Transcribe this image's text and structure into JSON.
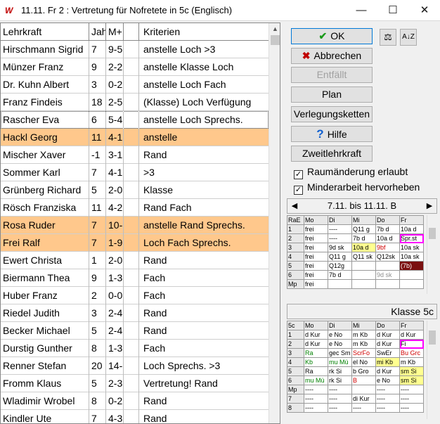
{
  "window": {
    "icon": "W",
    "title": "11.11. Fr 2 : Vertretung für Nofretete in 5c (Englisch)",
    "minimize": "—",
    "maximize": "☐",
    "close": "✕"
  },
  "table": {
    "headers": [
      "Lehrkraft",
      "Jah",
      "M+",
      "",
      "Kriterien"
    ],
    "rows": [
      {
        "name": "Hirschmann Sigrid",
        "jah": "7",
        "m": "9-5",
        "x": "",
        "krit": "anstelle Loch >3",
        "hl": false,
        "sel": false
      },
      {
        "name": "Münzer Franz",
        "jah": "9",
        "m": "2-2",
        "x": "",
        "krit": "anstelle Klasse Loch",
        "hl": false,
        "sel": false
      },
      {
        "name": "Dr. Kuhn Albert",
        "jah": "3",
        "m": "0-2",
        "x": "",
        "krit": "anstelle Loch Fach",
        "hl": false,
        "sel": false
      },
      {
        "name": "Franz Findeis",
        "jah": "18",
        "m": "2-5",
        "x": "",
        "krit": "(Klasse) Loch Verfügung",
        "hl": false,
        "sel": false
      },
      {
        "name": "Rascher Eva",
        "jah": "6",
        "m": "5-4",
        "x": "",
        "krit": "anstelle Loch Sprechs.",
        "hl": false,
        "sel": true
      },
      {
        "name": "Hackl Georg",
        "jah": "11",
        "m": "4-1",
        "x": "",
        "krit": "anstelle",
        "hl": true,
        "sel": false
      },
      {
        "name": "Mischer Xaver",
        "jah": "-1",
        "m": "3-1",
        "x": "",
        "krit": "Rand",
        "hl": false,
        "sel": false
      },
      {
        "name": "Sommer Karl",
        "jah": "7",
        "m": "4-1",
        "x": "",
        "krit": ">3",
        "hl": false,
        "sel": false
      },
      {
        "name": "Grünberg Richard",
        "jah": "5",
        "m": "2-0",
        "x": "",
        "krit": "Klasse",
        "hl": false,
        "sel": false
      },
      {
        "name": "Rösch Franziska",
        "jah": "11",
        "m": "4-2",
        "x": "",
        "krit": "Rand Fach",
        "hl": false,
        "sel": false
      },
      {
        "name": "Rosa Ruder",
        "jah": "7",
        "m": "10-",
        "x": "",
        "krit": "anstelle Rand Sprechs.",
        "hl": true,
        "sel": false
      },
      {
        "name": "Frei Ralf",
        "jah": "7",
        "m": "1-9",
        "x": "",
        "krit": "Loch Fach Sprechs.",
        "hl": true,
        "sel": false
      },
      {
        "name": "Ewert Christa",
        "jah": "1",
        "m": "2-0",
        "x": "",
        "krit": "Rand",
        "hl": false,
        "sel": false
      },
      {
        "name": "Biermann Thea",
        "jah": "9",
        "m": "1-3",
        "x": "",
        "krit": "Fach",
        "hl": false,
        "sel": false
      },
      {
        "name": "Huber Franz",
        "jah": "2",
        "m": "0-0",
        "x": "",
        "krit": "Fach",
        "hl": false,
        "sel": false
      },
      {
        "name": "Riedel Judith",
        "jah": "3",
        "m": "2-4",
        "x": "",
        "krit": "Rand",
        "hl": false,
        "sel": false
      },
      {
        "name": "Becker Michael",
        "jah": "5",
        "m": "2-4",
        "x": "",
        "krit": "Rand",
        "hl": false,
        "sel": false
      },
      {
        "name": "Durstig Gunther",
        "jah": "8",
        "m": "1-3",
        "x": "",
        "krit": "Fach",
        "hl": false,
        "sel": false
      },
      {
        "name": "Renner Stefan",
        "jah": "20",
        "m": "14-",
        "x": "",
        "krit": "Loch Sprechs. >3",
        "hl": false,
        "sel": false
      },
      {
        "name": "Fromm Klaus",
        "jah": "5",
        "m": "2-3",
        "x": "",
        "krit": "Vertretung! Rand",
        "hl": false,
        "sel": false
      },
      {
        "name": "Wladimir Wrobel",
        "jah": "8",
        "m": "0-2",
        "x": "",
        "krit": "Rand",
        "hl": false,
        "sel": false
      },
      {
        "name": "Kindler Ute",
        "jah": "7",
        "m": "4-3",
        "x": "",
        "krit": "Rand",
        "hl": false,
        "sel": false
      }
    ]
  },
  "buttons": {
    "ok": "OK",
    "abbrechen": "Abbrechen",
    "entfaellt": "Entfällt",
    "plan": "Plan",
    "verlegungsketten": "Verlegungsketten",
    "hilfe": "Hilfe",
    "zweitlehrkraft": "Zweitlehrkraft"
  },
  "sidebuttons": {
    "balance": "⚖",
    "sort": "A↓Z"
  },
  "icons": {
    "ok": "✔",
    "abbrechen": "✖",
    "hilfe": "?",
    "colors": {
      "ok": "#1a9a1a",
      "abbrechen": "#c00000",
      "hilfe": "#1060d0"
    }
  },
  "checkboxes": {
    "raum": "Raumänderung erlaubt",
    "minder": "Minderarbeit hervorheben",
    "mark": "✓"
  },
  "week": {
    "prev": "◀",
    "label": "7.11. bis 11.11. B",
    "next": "▶"
  },
  "raum_grid": {
    "corner": "RaE",
    "days": [
      "Mo",
      "Di",
      "Mi",
      "Do",
      "Fr"
    ],
    "rows": [
      {
        "h": "1",
        "cells": [
          [
            "frei",
            ""
          ],
          [
            "----",
            ""
          ],
          [
            "Q11 g",
            ""
          ],
          [
            "7b d",
            ""
          ],
          [
            "10a d",
            ""
          ]
        ]
      },
      {
        "h": "2",
        "cells": [
          [
            "frei",
            ""
          ],
          [
            "----",
            ""
          ],
          [
            "7b d",
            ""
          ],
          [
            "10a d",
            ""
          ],
          [
            "Spr.st",
            "pk"
          ]
        ]
      },
      {
        "h": "3",
        "cells": [
          [
            "frei",
            ""
          ],
          [
            "9d sk",
            ""
          ],
          [
            "10a d",
            "y"
          ],
          [
            "9bf",
            "red"
          ],
          [
            "10a sk",
            ""
          ]
        ]
      },
      {
        "h": "4",
        "cells": [
          [
            "frei",
            ""
          ],
          [
            "Q11 g",
            ""
          ],
          [
            "Q11 sk",
            ""
          ],
          [
            "Q12sk",
            ""
          ],
          [
            "10a sk",
            ""
          ]
        ]
      },
      {
        "h": "5",
        "cells": [
          [
            "frei",
            ""
          ],
          [
            "Q12g",
            ""
          ],
          [
            "",
            ""
          ],
          [
            "",
            ""
          ],
          [
            "(7b)",
            "dr"
          ]
        ]
      },
      {
        "h": "6",
        "cells": [
          [
            "frei",
            ""
          ],
          [
            "7b d",
            ""
          ],
          [
            "",
            ""
          ],
          [
            "9d sk",
            "gry"
          ],
          [
            "",
            ""
          ]
        ]
      },
      {
        "h": "Mp",
        "cells": [
          [
            "frei",
            ""
          ],
          [
            "",
            ""
          ],
          [
            "",
            ""
          ],
          [
            "",
            ""
          ],
          [
            "",
            ""
          ]
        ]
      }
    ]
  },
  "klasse_label": "Klasse 5c",
  "klasse_grid": {
    "corner": "5c",
    "days": [
      "Mo",
      "Di",
      "Mi",
      "Do",
      "Fr"
    ],
    "rows": [
      {
        "h": "1",
        "cells": [
          [
            "d  Kur",
            ""
          ],
          [
            "e  No",
            ""
          ],
          [
            "m  Kb",
            ""
          ],
          [
            "d  Kur",
            ""
          ],
          [
            "d  Kur",
            ""
          ]
        ]
      },
      {
        "h": "2",
        "cells": [
          [
            "d  Kur",
            ""
          ],
          [
            "e  No",
            ""
          ],
          [
            "m  Kb",
            ""
          ],
          [
            "d  Kur",
            ""
          ],
          [
            "Fi",
            "pk"
          ]
        ]
      },
      {
        "h": "3",
        "cells": [
          [
            "Ra",
            "grn"
          ],
          [
            "gec Sm",
            ""
          ],
          [
            "ScrFo",
            "red"
          ],
          [
            "SwEr",
            ""
          ],
          [
            "Bu Grc",
            "red"
          ]
        ]
      },
      {
        "h": "4",
        "cells": [
          [
            "Kb",
            "grn"
          ],
          [
            "mu Mü",
            "grn"
          ],
          [
            "el  No",
            ""
          ],
          [
            "mi  Kb",
            "y"
          ],
          [
            "m  Kb",
            ""
          ]
        ]
      },
      {
        "h": "5",
        "cells": [
          [
            "Ra",
            ""
          ],
          [
            "rk  Si",
            ""
          ],
          [
            "b  Gro",
            ""
          ],
          [
            "d  Kur",
            ""
          ],
          [
            "sm Si",
            "y"
          ]
        ]
      },
      {
        "h": "6",
        "cells": [
          [
            "mu Mü",
            "grn"
          ],
          [
            "rk  Si",
            ""
          ],
          [
            "B",
            "red"
          ],
          [
            "e  No",
            ""
          ],
          [
            "sm Si",
            "y"
          ]
        ]
      },
      {
        "h": "Mp",
        "cells": [
          [
            "----",
            ""
          ],
          [
            "----",
            ""
          ],
          [
            "",
            ""
          ],
          [
            "----",
            ""
          ],
          [
            "----",
            ""
          ]
        ]
      },
      {
        "h": "7",
        "cells": [
          [
            "----",
            ""
          ],
          [
            "----",
            ""
          ],
          [
            "di  Kur",
            ""
          ],
          [
            "----",
            ""
          ],
          [
            "----",
            ""
          ]
        ]
      },
      {
        "h": "8",
        "cells": [
          [
            "----",
            ""
          ],
          [
            "----",
            ""
          ],
          [
            "----",
            ""
          ],
          [
            "----",
            ""
          ],
          [
            "----",
            ""
          ]
        ]
      }
    ]
  }
}
